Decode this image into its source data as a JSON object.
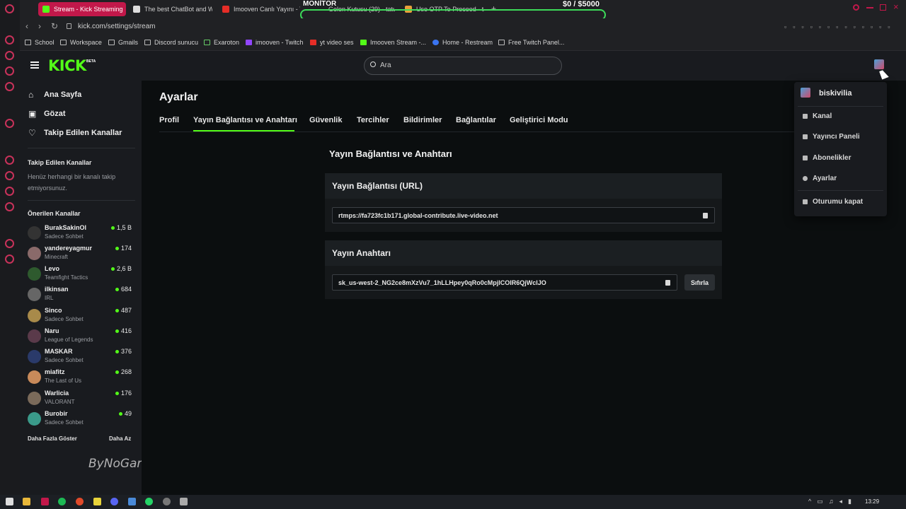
{
  "browser": {
    "tabs": [
      {
        "label": "Stream - Kick Streaming",
        "active": true
      },
      {
        "label": "The best ChatBot and W...",
        "active": false
      },
      {
        "label": "Imooven Canlı Yayını - Yo...",
        "active": false
      },
      {
        "label": "Gelen Kutusu (29) - tatu...",
        "active": false
      },
      {
        "label": "Use OTP To Proceed - ta...",
        "active": false
      }
    ],
    "overlay_monitor": "MONİTÖR",
    "overlay_goal": "$0  / $5000",
    "url": "kick.com/settings/stream",
    "bookmarks": [
      "School",
      "Workspace",
      "Gmails",
      "Discord sunucu",
      "Exaroton",
      "imooven - Twitch",
      "yt video ses",
      "Imooven Stream -...",
      "Home - Restream",
      "Free Twitch Panel..."
    ]
  },
  "header": {
    "logo": "KICK",
    "logo_badge": "BETA",
    "search_placeholder": "Ara"
  },
  "sidebar": {
    "nav": [
      {
        "label": "Ana Sayfa",
        "icon": "home-icon"
      },
      {
        "label": "Gözat",
        "icon": "browse-icon"
      },
      {
        "label": "Takip Edilen Kanallar",
        "icon": "heart-icon"
      }
    ],
    "followed_heading": "Takip Edilen Kanallar",
    "followed_empty": "Henüz herhangi bir kanalı takip etmiyorsunuz.",
    "recommended_heading": "Önerilen Kanallar",
    "channels": [
      {
        "name": "BurakSakinOl",
        "category": "Sadece Sohbet",
        "viewers": "1,5 B"
      },
      {
        "name": "yandereyagmur",
        "category": "Minecraft",
        "viewers": "174"
      },
      {
        "name": "Levo",
        "category": "Teamfight Tactics",
        "viewers": "2,6 B"
      },
      {
        "name": "ilkinsan",
        "category": "IRL",
        "viewers": "684"
      },
      {
        "name": "Sinco",
        "category": "Sadece Sohbet",
        "viewers": "487"
      },
      {
        "name": "Naru",
        "category": "League of Legends",
        "viewers": "416"
      },
      {
        "name": "MASKAR",
        "category": "Sadece Sohbet",
        "viewers": "376"
      },
      {
        "name": "miafitz",
        "category": "The Last of Us",
        "viewers": "268"
      },
      {
        "name": "Warlicia",
        "category": "VALORANT",
        "viewers": "176"
      },
      {
        "name": "Burobir",
        "category": "Sadece Sohbet",
        "viewers": "49"
      }
    ],
    "show_more": "Daha Fazla Göster",
    "show_less": "Daha Az",
    "watermark": "ByNoGame"
  },
  "main": {
    "title": "Ayarlar",
    "tabs": [
      "Profil",
      "Yayın Bağlantısı ve Anahtarı",
      "Güvenlik",
      "Tercihler",
      "Bildirimler",
      "Bağlantılar",
      "Geliştirici Modu"
    ],
    "section_title": "Yayın Bağlantısı ve Anahtarı",
    "url_card_title": "Yayın Bağlantısı (URL)",
    "url_value": "rtmps://fa723fc1b171.global-contribute.live-video.net",
    "key_card_title": "Yayın Anahtarı",
    "key_value": "sk_us-west-2_NG2ce8mXzVu7_1hLLHpey0qRo0cMpjlCOIR6QjWclJO",
    "reset_label": "Sıfırla"
  },
  "dropdown": {
    "username": "biskivilia",
    "items": [
      "Kanal",
      "Yayıncı Paneli",
      "Abonelikler",
      "Ayarlar",
      "Oturumu kapat"
    ]
  },
  "taskbar": {
    "clock": "13:29"
  },
  "colors": {
    "kick_green": "#53fc18",
    "opera_red": "#c2184a"
  }
}
